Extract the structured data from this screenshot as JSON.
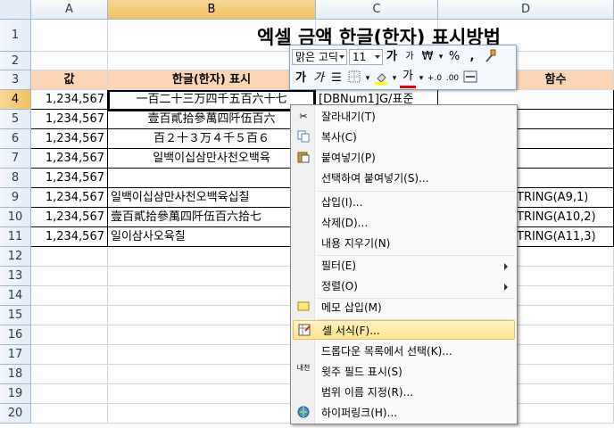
{
  "columns": [
    "A",
    "B",
    "C",
    "D"
  ],
  "rows": [
    "1",
    "2",
    "3",
    "4",
    "5",
    "6",
    "7",
    "8",
    "9",
    "10",
    "11",
    "12",
    "13",
    "14",
    "15",
    "16",
    "17",
    "18",
    "19",
    "20"
  ],
  "title": "엑셀 금액 한글(한자) 표시방법",
  "headers": {
    "a": "값",
    "b": "한글(한자) 표시",
    "c": "",
    "d": "함수"
  },
  "data_rows": [
    {
      "a": "1,234,567",
      "b": "一百二十三万四千五百六十七",
      "c": "[DBNum1]G/표준",
      "d": ""
    },
    {
      "a": "1,234,567",
      "b": "壹百貳拾參萬四阡伍百六",
      "c": "",
      "d": ""
    },
    {
      "a": "1,234,567",
      "b": "百２十３万４千５百６",
      "c": "",
      "d": ""
    },
    {
      "a": "1,234,567",
      "b": "일백이십삼만사천오백육",
      "c": "",
      "d": ""
    },
    {
      "a": "1,234,567",
      "b": "",
      "c": "",
      "d": ""
    },
    {
      "a": "1,234,567",
      "b": "일백이십삼만사천오백육십칠",
      "c": "",
      "d": "TRING(A9,1)"
    },
    {
      "a": "1,234,567",
      "b": "壹百貳拾參萬四阡伍百六拾七",
      "c": "",
      "d": "TRING(A10,2)"
    },
    {
      "a": "1,234,567",
      "b": "일이삼사오육칠",
      "c": "",
      "d": "TRING(A11,3)"
    }
  ],
  "mini_toolbar": {
    "font_name": "맑은 고딕",
    "font_size": "11",
    "grow_font": "가",
    "shrink_font": "가",
    "currency": "₩",
    "percent": "%",
    "comma": ",",
    "bold": "가",
    "italic": "가",
    "font_color_label": "가"
  },
  "context_menu": {
    "cut": "잘라내기(T)",
    "copy": "복사(C)",
    "paste": "붙여넣기(P)",
    "paste_special": "선택하여 붙여넣기(S)...",
    "insert": "삽입(I)...",
    "delete": "삭제(D)...",
    "clear_contents": "내용 지우기(N)",
    "filter": "필터(E)",
    "sort": "정렬(O)",
    "insert_comment": "메모 삽입(M)",
    "format_cells": "셀 서식(F)...",
    "pick_from_list": "드롭다운 목록에서 선택(K)...",
    "phonetic": "윗주 필드 표시(S)",
    "define_name": "범위 이름 지정(R)...",
    "hyperlink": "하이퍼링크(H)...",
    "phonetic_icon_text": "내천"
  },
  "colors": {
    "header_fill": "#fcd5b4",
    "highlight": "#ffe38c",
    "selected_header": "#f1c15f"
  }
}
